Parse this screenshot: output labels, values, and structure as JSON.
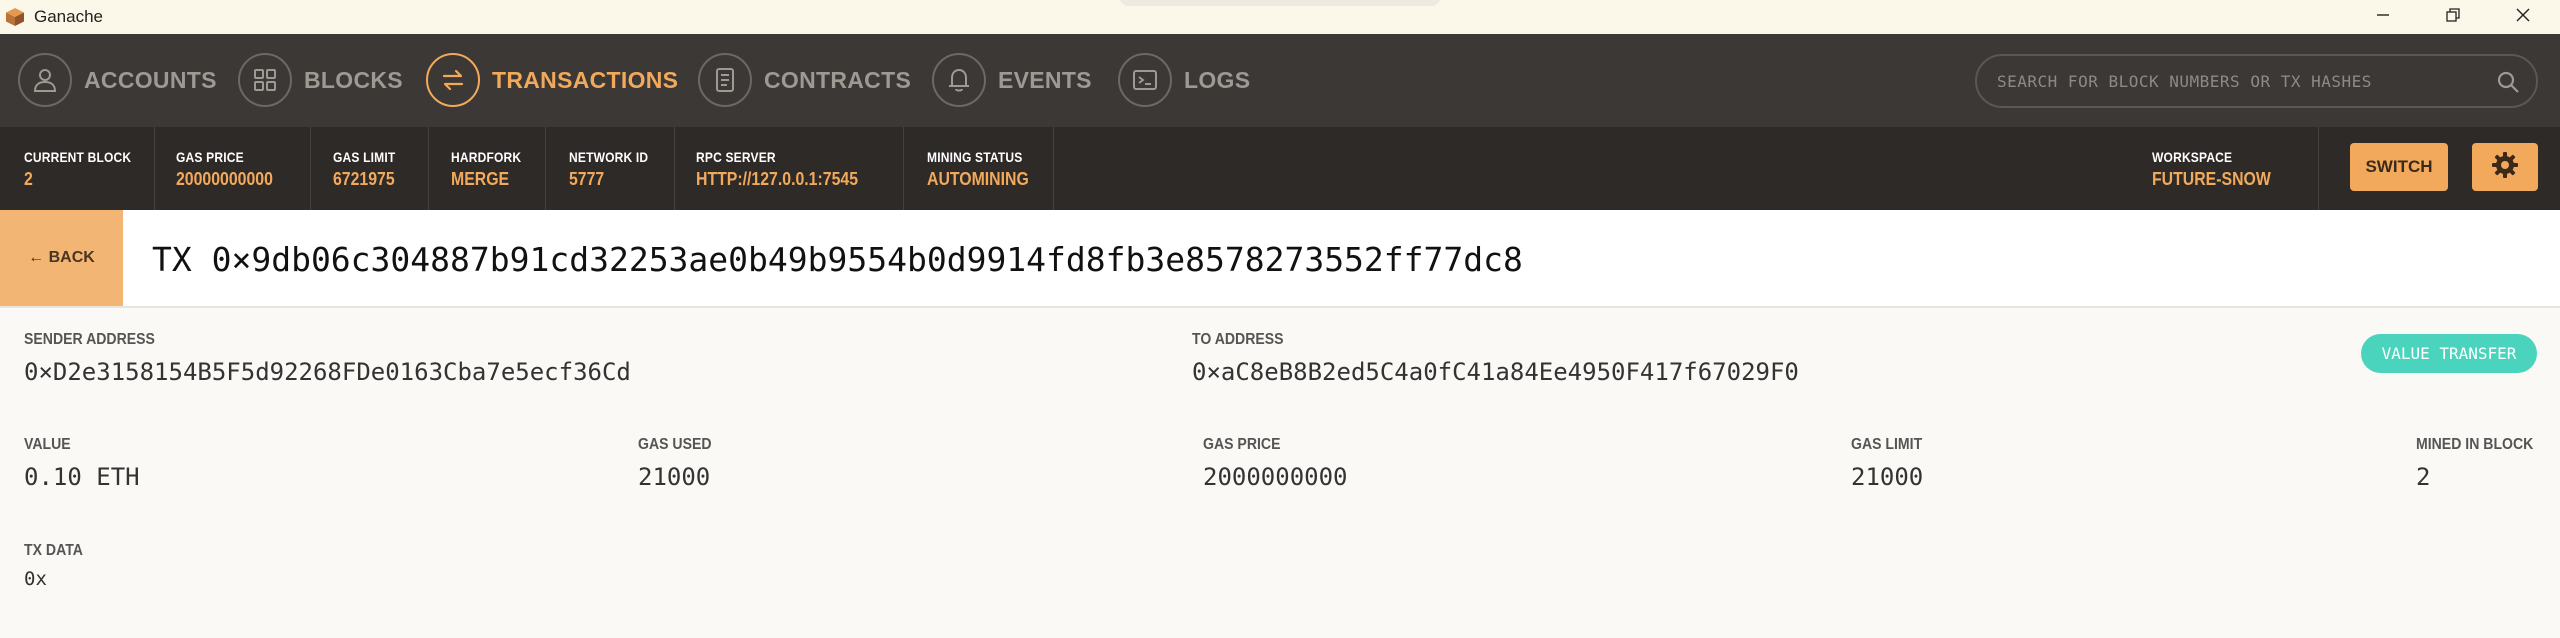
{
  "window": {
    "title": "Ganache"
  },
  "nav": {
    "items": [
      {
        "label": "ACCOUNTS",
        "icon": "person-icon"
      },
      {
        "label": "BLOCKS",
        "icon": "grid-icon"
      },
      {
        "label": "TRANSACTIONS",
        "icon": "swap-arrows-icon"
      },
      {
        "label": "CONTRACTS",
        "icon": "document-icon"
      },
      {
        "label": "EVENTS",
        "icon": "bell-icon"
      },
      {
        "label": "LOGS",
        "icon": "terminal-icon"
      }
    ],
    "active": "TRANSACTIONS",
    "search_placeholder": "SEARCH FOR BLOCK NUMBERS OR TX HASHES"
  },
  "status": {
    "current_block": {
      "label": "CURRENT BLOCK",
      "value": "2"
    },
    "gas_price": {
      "label": "GAS PRICE",
      "value": "20000000000"
    },
    "gas_limit": {
      "label": "GAS LIMIT",
      "value": "6721975"
    },
    "hardfork": {
      "label": "HARDFORK",
      "value": "MERGE"
    },
    "network_id": {
      "label": "NETWORK ID",
      "value": "5777"
    },
    "rpc_server": {
      "label": "RPC SERVER",
      "value": "HTTP://127.0.0.1:7545"
    },
    "mining_status": {
      "label": "MINING STATUS",
      "value": "AUTOMINING"
    },
    "workspace": {
      "label": "WORKSPACE",
      "value": "FUTURE-SNOW"
    },
    "switch_label": "SWITCH"
  },
  "tx": {
    "back_label": "← BACK",
    "title": "TX 0×9db06c304887b91cd32253ae0b49b9554b0d9914fd8fb3e8578273552ff77dc8",
    "sender": {
      "label": "SENDER ADDRESS",
      "value": "0×D2e3158154B5F5d92268FDe0163Cba7e5ecf36Cd"
    },
    "to": {
      "label": "TO ADDRESS",
      "value": "0×aC8eB8B2ed5C4a0fC41a84Ee4950F417f67029F0"
    },
    "type_badge": "VALUE TRANSFER",
    "value": {
      "label": "VALUE",
      "value": "0.10 ETH"
    },
    "gas_used": {
      "label": "GAS USED",
      "value": "21000"
    },
    "gas_price": {
      "label": "GAS PRICE",
      "value": "2000000000"
    },
    "gas_limit": {
      "label": "GAS LIMIT",
      "value": "21000"
    },
    "mined_in_block": {
      "label": "MINED IN BLOCK",
      "value": "2"
    },
    "tx_data": {
      "label": "TX DATA",
      "value": "0x"
    }
  },
  "colors": {
    "accent": "#f3a95b",
    "nav_bg": "#3b3835",
    "status_bg": "#2d2a28",
    "badge": "#4ad4bd"
  }
}
